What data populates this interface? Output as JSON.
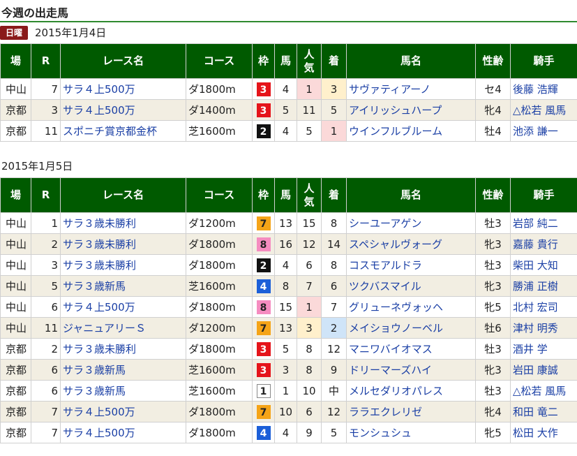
{
  "page_title": "今週の出走馬",
  "headers": [
    "場",
    "R",
    "レース名",
    "コース",
    "枠",
    "馬",
    "人気",
    "着",
    "馬名",
    "性齢",
    "騎手"
  ],
  "frame_colors": {
    "1": {
      "bg": "#ffffff",
      "fg": "#222222",
      "border": "#888888"
    },
    "2": {
      "bg": "#111111",
      "fg": "#ffffff",
      "border": "#111111"
    },
    "3": {
      "bg": "#e5141a",
      "fg": "#ffffff",
      "border": "#e5141a"
    },
    "4": {
      "bg": "#1c5fd8",
      "fg": "#ffffff",
      "border": "#1c5fd8"
    },
    "7": {
      "bg": "#f5a418",
      "fg": "#222222",
      "border": "#f5a418"
    },
    "8": {
      "bg": "#f58cc0",
      "fg": "#222222",
      "border": "#f58cc0"
    }
  },
  "sections": [
    {
      "day_badge": "日曜",
      "date": "2015年1月4日",
      "rows": [
        {
          "venue": "中山",
          "race": "7",
          "name": "サラ４上500万",
          "course": "ダ1800m",
          "frame": "3",
          "horse_no": "4",
          "popularity": "1",
          "finish": "3",
          "horse": "サヴァティアーノ",
          "sex_age": "セ4",
          "jockey": "後藤 浩輝"
        },
        {
          "venue": "京都",
          "race": "3",
          "name": "サラ４上500万",
          "course": "ダ1400m",
          "frame": "3",
          "horse_no": "5",
          "popularity": "11",
          "finish": "5",
          "horse": "アイリッシュハープ",
          "sex_age": "牝4",
          "jockey": "△松若 風馬"
        },
        {
          "venue": "京都",
          "race": "11",
          "name": "スポニチ賞京都金杯",
          "course": "芝1600m",
          "frame": "2",
          "horse_no": "4",
          "popularity": "5",
          "finish": "1",
          "horse": "ウインフルブルーム",
          "sex_age": "牡4",
          "jockey": "池添 謙一"
        }
      ]
    },
    {
      "day_badge": "",
      "date": "2015年1月5日",
      "rows": [
        {
          "venue": "中山",
          "race": "1",
          "name": "サラ３歳未勝利",
          "course": "ダ1200m",
          "frame": "7",
          "horse_no": "13",
          "popularity": "15",
          "finish": "8",
          "horse": "シーユーアゲン",
          "sex_age": "牡3",
          "jockey": "岩部 純二"
        },
        {
          "venue": "中山",
          "race": "2",
          "name": "サラ３歳未勝利",
          "course": "ダ1800m",
          "frame": "8",
          "horse_no": "16",
          "popularity": "12",
          "finish": "14",
          "horse": "スペシャルヴォーグ",
          "sex_age": "牝3",
          "jockey": "嘉藤 貴行"
        },
        {
          "venue": "中山",
          "race": "3",
          "name": "サラ３歳未勝利",
          "course": "ダ1800m",
          "frame": "2",
          "horse_no": "4",
          "popularity": "6",
          "finish": "8",
          "horse": "コスモアルドラ",
          "sex_age": "牡3",
          "jockey": "柴田 大知"
        },
        {
          "venue": "中山",
          "race": "5",
          "name": "サラ３歳新馬",
          "course": "芝1600m",
          "frame": "4",
          "horse_no": "8",
          "popularity": "7",
          "finish": "6",
          "horse": "ツクバスマイル",
          "sex_age": "牝3",
          "jockey": "勝浦 正樹"
        },
        {
          "venue": "中山",
          "race": "6",
          "name": "サラ４上500万",
          "course": "ダ1800m",
          "frame": "8",
          "horse_no": "15",
          "popularity": "1",
          "finish": "7",
          "horse": "グリューネヴォッヘ",
          "sex_age": "牝5",
          "jockey": "北村 宏司"
        },
        {
          "venue": "中山",
          "race": "11",
          "name": "ジャニュアリーＳ",
          "course": "ダ1200m",
          "frame": "7",
          "horse_no": "13",
          "popularity": "3",
          "finish": "2",
          "horse": "メイショウノーベル",
          "sex_age": "牡6",
          "jockey": "津村 明秀"
        },
        {
          "venue": "京都",
          "race": "2",
          "name": "サラ３歳未勝利",
          "course": "ダ1800m",
          "frame": "3",
          "horse_no": "5",
          "popularity": "8",
          "finish": "12",
          "horse": "マニワバイオマス",
          "sex_age": "牡3",
          "jockey": "酒井 学"
        },
        {
          "venue": "京都",
          "race": "6",
          "name": "サラ３歳新馬",
          "course": "芝1600m",
          "frame": "3",
          "horse_no": "3",
          "popularity": "8",
          "finish": "9",
          "horse": "ドリーマーズハイ",
          "sex_age": "牝3",
          "jockey": "岩田 康誠"
        },
        {
          "venue": "京都",
          "race": "6",
          "name": "サラ３歳新馬",
          "course": "芝1600m",
          "frame": "1",
          "horse_no": "1",
          "popularity": "10",
          "finish": "中",
          "horse": "メルセダリオパレス",
          "sex_age": "牡3",
          "jockey": "△松若 風馬"
        },
        {
          "venue": "京都",
          "race": "7",
          "name": "サラ４上500万",
          "course": "ダ1800m",
          "frame": "7",
          "horse_no": "10",
          "popularity": "6",
          "finish": "12",
          "horse": "ララエクレリゼ",
          "sex_age": "牝4",
          "jockey": "和田 竜二"
        },
        {
          "venue": "京都",
          "race": "7",
          "name": "サラ４上500万",
          "course": "ダ1800m",
          "frame": "4",
          "horse_no": "4",
          "popularity": "9",
          "finish": "5",
          "horse": "モンシュシュ",
          "sex_age": "牝5",
          "jockey": "松田 大作"
        }
      ]
    }
  ]
}
